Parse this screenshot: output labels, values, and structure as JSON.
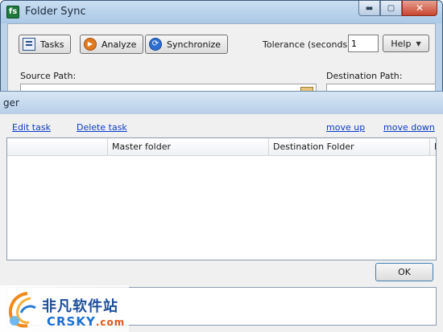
{
  "window": {
    "title": "Folder Sync",
    "icon_label": "fs",
    "controls": {
      "minimize": "▬",
      "maximize": "▢",
      "close": "✕"
    }
  },
  "toolbar": {
    "tasks_label": "Tasks",
    "analyze_label": "Analyze",
    "synchronize_label": "Synchronize",
    "tolerance_label": "Tolerance (seconds)",
    "tolerance_value": "1",
    "help_label": "Help"
  },
  "paths": {
    "source_label": "Source Path:",
    "destination_label": "Destination Path:"
  },
  "task_manager": {
    "title": "ger",
    "links": {
      "edit": "Edit task",
      "delete": "Delete task",
      "move_up": "move up",
      "move_down": "move down"
    },
    "columns": [
      "",
      "Master folder",
      "Destination Folder",
      "F"
    ],
    "ok_label": "OK"
  },
  "watermark": {
    "chinese": "非凡软件站",
    "latin": "CRSKY",
    "suffix": ".com"
  },
  "colors": {
    "link": "#0a3cc9",
    "window_frame": "#bcd3ea",
    "close_button": "#c7462f"
  },
  "icons": [
    "tasks-icon",
    "analyze-icon",
    "synchronize-icon",
    "chevron-down-icon"
  ]
}
